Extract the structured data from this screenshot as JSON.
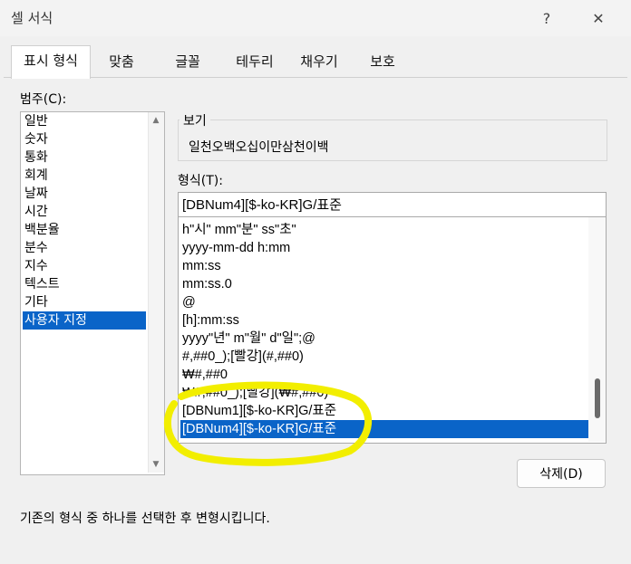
{
  "window": {
    "title": "셀 서식",
    "help_label": "?",
    "close_label": "✕"
  },
  "tabs": [
    "표시 형식",
    "맞춤",
    "글꼴",
    "테두리",
    "채우기",
    "보호"
  ],
  "active_tab": "표시 형식",
  "category": {
    "label": "범주(C):",
    "items": [
      "일반",
      "숫자",
      "통화",
      "회계",
      "날짜",
      "시간",
      "백분율",
      "분수",
      "지수",
      "텍스트",
      "기타",
      "사용자 지정"
    ],
    "selected": "사용자 지정"
  },
  "sample": {
    "legend": "보기",
    "value": "일천오백오십이만삼천이백"
  },
  "format": {
    "label": "형식(T):",
    "value": "[DBNum4][$-ko-KR]G/표준",
    "list": [
      "h\"시\" mm\"분\" ss\"초\"",
      "yyyy-mm-dd h:mm",
      "mm:ss",
      "mm:ss.0",
      "@",
      "[h]:mm:ss",
      "yyyy\"년\" m\"월\" d\"일\";@",
      "#,##0_);[빨강](#,##0)",
      "₩#,##0",
      "₩#,##0_);[빨강](₩#,##0)",
      "[DBNum1][$-ko-KR]G/표준",
      "[DBNum4][$-ko-KR]G/표준"
    ],
    "selected": "[DBNum4][$-ko-KR]G/표준"
  },
  "delete_button": "삭제(D)",
  "description": "기존의 형식 중 하나를 선택한 후 변형시킵니다.",
  "colors": {
    "selection": "#0a64c8",
    "highlight_annotation": "#f2ee00"
  }
}
